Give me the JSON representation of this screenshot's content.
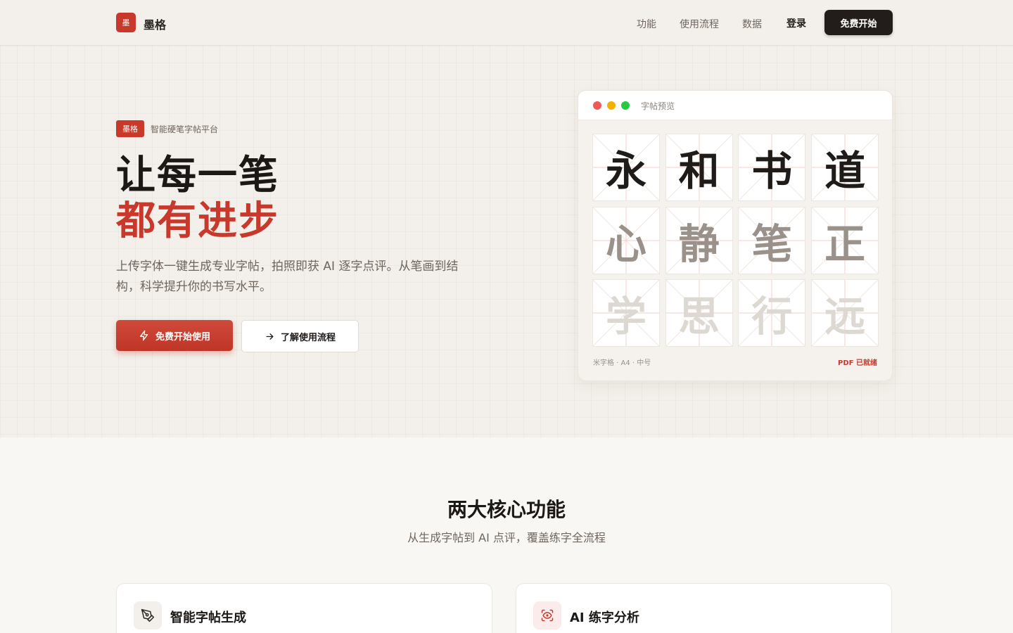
{
  "header": {
    "logo_char": "墨",
    "brand": "墨格",
    "nav": [
      {
        "label": "功能"
      },
      {
        "label": "使用流程"
      },
      {
        "label": "数据"
      }
    ],
    "login": "登录",
    "cta": "免费开始"
  },
  "hero": {
    "tag": "墨格",
    "tag_text": "智能硬笔字帖平台",
    "title_line1": "让每一笔",
    "title_line2": "都有进步",
    "description": "上传字体一键生成专业字帖，拍照即获 AI 逐字点评。从笔画到结构，科学提升你的书写水平。",
    "primary_button": "免费开始使用",
    "secondary_button": "了解使用流程"
  },
  "preview": {
    "title": "字帖预览",
    "chars": [
      "永",
      "和",
      "书",
      "道",
      "心",
      "静",
      "笔",
      "正",
      "学",
      "思",
      "行",
      "远"
    ],
    "row_colors": [
      "#1f1b18",
      "#9a928a",
      "#ddd8d2"
    ],
    "meta": "米字格 · A4 · 中号",
    "status": "PDF 已就绪",
    "dot_colors": [
      "#ef5a57",
      "#f2b100",
      "#27c93f"
    ]
  },
  "features": {
    "title": "两大核心功能",
    "subtitle": "从生成字帖到 AI 点评，覆盖练字全流程",
    "cards": [
      {
        "title": "智能字帖生成",
        "icon": "pen-icon"
      },
      {
        "title": "AI 练字分析",
        "icon": "scan-eye-icon"
      }
    ]
  },
  "colors": {
    "accent": "#c8392b",
    "dark": "#221d1a"
  }
}
